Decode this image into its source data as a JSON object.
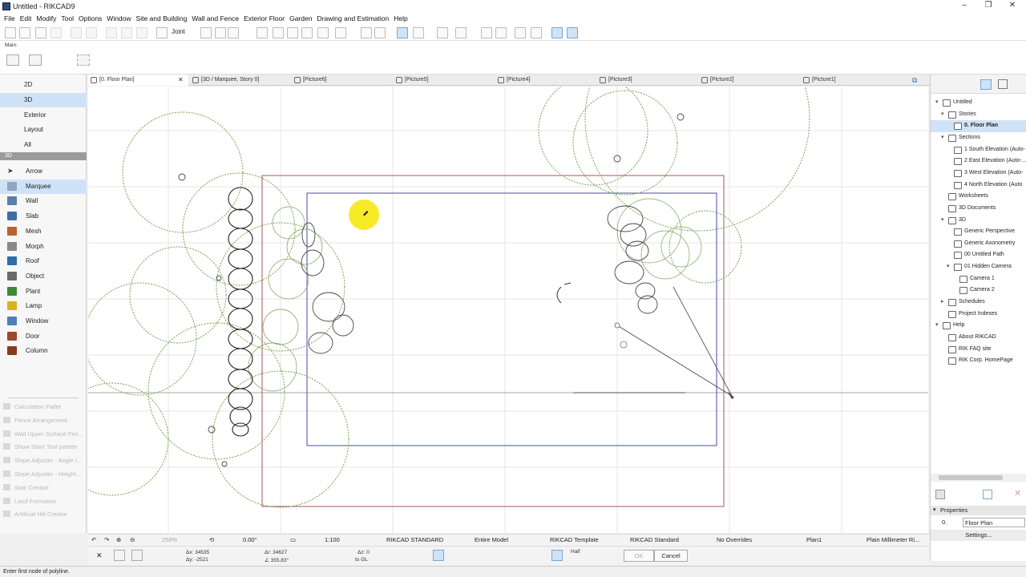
{
  "window": {
    "title": "Untitled - RIKCAD9"
  },
  "menu": [
    "File",
    "Edit",
    "Modify",
    "Tool",
    "Options",
    "Window",
    "Site and Building",
    "Wall and Fence",
    "Exterior Floor",
    "Garden",
    "Drawing and Estimation",
    "Help"
  ],
  "toolbar": {
    "joint_label": "Joint"
  },
  "infobox": {
    "label": "Main:"
  },
  "views": [
    "2D",
    "3D",
    "Exterior",
    "Layout",
    "All"
  ],
  "section_label": "3D",
  "tools": [
    {
      "label": "Arrow",
      "color": "#333333"
    },
    {
      "label": "Marquee",
      "color": "#8fa6c0"
    },
    {
      "label": "Wall",
      "color": "#5a7fa8"
    },
    {
      "label": "Slab",
      "color": "#3d6fa6"
    },
    {
      "label": "Mesh",
      "color": "#b8632a"
    },
    {
      "label": "Morph",
      "color": "#888888"
    },
    {
      "label": "Roof",
      "color": "#2f6ea8"
    },
    {
      "label": "Object",
      "color": "#6a6a6a"
    },
    {
      "label": "Plant",
      "color": "#3f8a34"
    },
    {
      "label": "Lamp",
      "color": "#d6b420"
    },
    {
      "label": "Window",
      "color": "#4a80b8"
    },
    {
      "label": "Door",
      "color": "#9b4a2a"
    },
    {
      "label": "Column",
      "color": "#8b3a1a"
    }
  ],
  "extras": [
    "Calculation Pallet",
    "Fence Arrangement",
    "Wall Upper Surface Fini...",
    "Show Slant Tool palette",
    "Slope Adjuster - Angle I...",
    "Slope Adjuster - Height...",
    "Stair Creator",
    "Land Formation",
    "Artificial Hill Creator"
  ],
  "tabs": [
    "[0. Floor Plan]",
    "[3D / Marquee, Story 0]",
    "[Picture6]",
    "[Picture5]",
    "[Picture4]",
    "[Picture3]",
    "[Picture2]",
    "[Picture1]"
  ],
  "tree": [
    {
      "label": "Untitled",
      "lvl": 0,
      "arrow": "▾"
    },
    {
      "label": "Stories",
      "lvl": 1,
      "arrow": "▾"
    },
    {
      "label": "0. Floor Plan",
      "lvl": 2,
      "arrow": "",
      "sel": true
    },
    {
      "label": "Sections",
      "lvl": 1,
      "arrow": "▾"
    },
    {
      "label": "1 South Elevation (Auto-",
      "lvl": 2,
      "arrow": ""
    },
    {
      "label": "2 East Elevation (Auto-...",
      "lvl": 2,
      "arrow": ""
    },
    {
      "label": "3 West Elevation (Auto-",
      "lvl": 2,
      "arrow": ""
    },
    {
      "label": "4 North Elevation (Auto",
      "lvl": 2,
      "arrow": ""
    },
    {
      "label": "Worksheets",
      "lvl": 1,
      "arrow": ""
    },
    {
      "label": "3D Documents",
      "lvl": 1,
      "arrow": ""
    },
    {
      "label": "3D",
      "lvl": 1,
      "arrow": "▾"
    },
    {
      "label": "Generic Perspective",
      "lvl": 2,
      "arrow": ""
    },
    {
      "label": "Generic Axonometry",
      "lvl": 2,
      "arrow": ""
    },
    {
      "label": "00 Untitled Path",
      "lvl": 2,
      "arrow": ""
    },
    {
      "label": "01 Hidden Camera",
      "lvl": 2,
      "arrow": "▾"
    },
    {
      "label": "Camera 1",
      "lvl": 3,
      "arrow": ""
    },
    {
      "label": "Camera 2",
      "lvl": 3,
      "arrow": ""
    },
    {
      "label": "Schedules",
      "lvl": 1,
      "arrow": "▸"
    },
    {
      "label": "Project Indexes",
      "lvl": 1,
      "arrow": ""
    },
    {
      "label": "Help",
      "lvl": 0,
      "arrow": "▾"
    },
    {
      "label": "About RIKCAD",
      "lvl": 1,
      "arrow": ""
    },
    {
      "label": "RIK FAQ site",
      "lvl": 1,
      "arrow": ""
    },
    {
      "label": "RIK Corp. HomePage",
      "lvl": 1,
      "arrow": ""
    }
  ],
  "properties": {
    "header": "Properties",
    "story": "0.",
    "value": "Floor Plan",
    "settings": "Settings..."
  },
  "navbar": {
    "zoom": "258%",
    "angle": "0.00°",
    "scale": "1:100",
    "layer": "RIKCAD STANDARD",
    "model": "Entire Model",
    "template": "RIKCAD Template",
    "standard": "RIKCAD Standard",
    "overrides": "No Overrides",
    "plan": "Plan1",
    "paper": "Plain Millimeter Ri..."
  },
  "coords": {
    "dx": "Δx: 34535",
    "dy": "Δy: -2521",
    "r": "Δr: 34627",
    "angle": "∠ 355.83°",
    "dz": "Δz: 0",
    "zref": "to GL",
    "half": "Half",
    "ok": "OK",
    "cancel": "Cancel"
  },
  "status": "Enter first node of polyline."
}
